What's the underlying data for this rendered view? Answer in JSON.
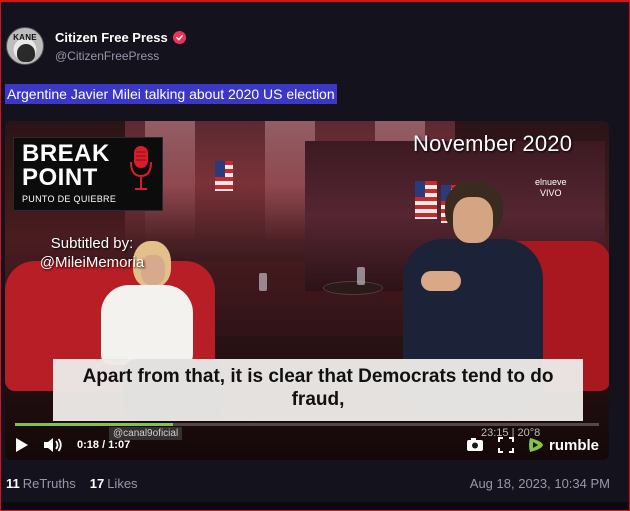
{
  "post": {
    "display_name": "Citizen Free Press",
    "handle": "@CitizenFreePress",
    "avatar_text": "KANE",
    "text": "Argentine Javier Milei talking about 2020 US election",
    "verified_icon": "verified-check-icon"
  },
  "video": {
    "logo_line1": "BREAK",
    "logo_line2": "POINT",
    "logo_sub": "PUNTO DE QUIEBRE",
    "subtitled_line1": "Subtitled by:",
    "subtitled_line2": "@MileiMemoria",
    "date_overlay": "November 2020",
    "channel_line1": "elnueve",
    "channel_line2": "VIVO",
    "subtitle_caption": "Apart from that, it is clear that Democrats tend to do fraud,",
    "watermark": "@canal9oficial",
    "watermark_right": "23:15 | 20°8",
    "progress": 0.27,
    "time_display": "0:18 / 1:07",
    "brand": "rumble",
    "icons": [
      "play-icon",
      "volume-icon",
      "settings-icon",
      "fullscreen-icon",
      "rumble-logo-icon"
    ]
  },
  "footer": {
    "retruths_count": "11",
    "retruths_label": "ReTruths",
    "likes_count": "17",
    "likes_label": "Likes",
    "timestamp": "Aug 18, 2023, 10:34 PM"
  },
  "colors": {
    "background": "#14121c",
    "frame": "#d4141a",
    "highlight": "#3b37c7",
    "verified": "#e8365a",
    "rumble_green": "#83c34a"
  }
}
